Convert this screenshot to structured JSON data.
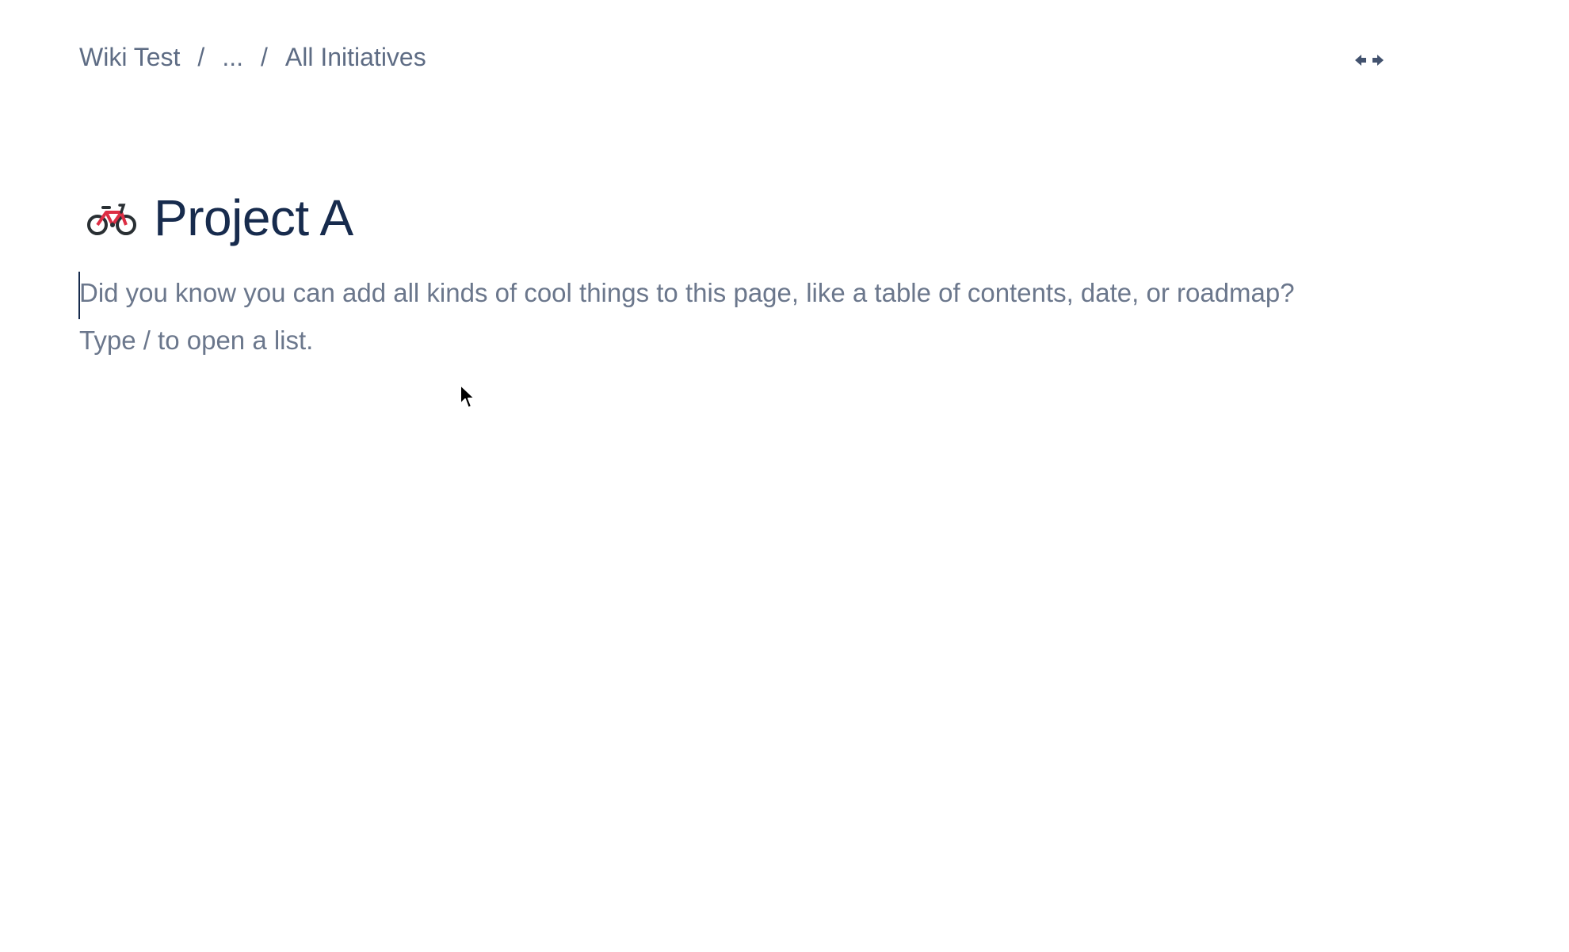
{
  "breadcrumb": {
    "items": [
      "Wiki Test",
      "...",
      "All Initiatives"
    ],
    "separator": "/"
  },
  "toolbar": {
    "width_toggle_icon": "expand-width-arrows-icon"
  },
  "page": {
    "emoji_icon": "bicycle-icon",
    "title": "Project A"
  },
  "editor": {
    "placeholder_line1": "Did you know you can add all kinds of cool things to this page, like a table of contents, date, or roadmap?",
    "placeholder_line2": "Type / to open a list."
  },
  "colors": {
    "title": "#172b4d",
    "muted_text": "#6b778c",
    "breadcrumb": "#5e6c84",
    "bike_frame": "#dd2e44"
  }
}
